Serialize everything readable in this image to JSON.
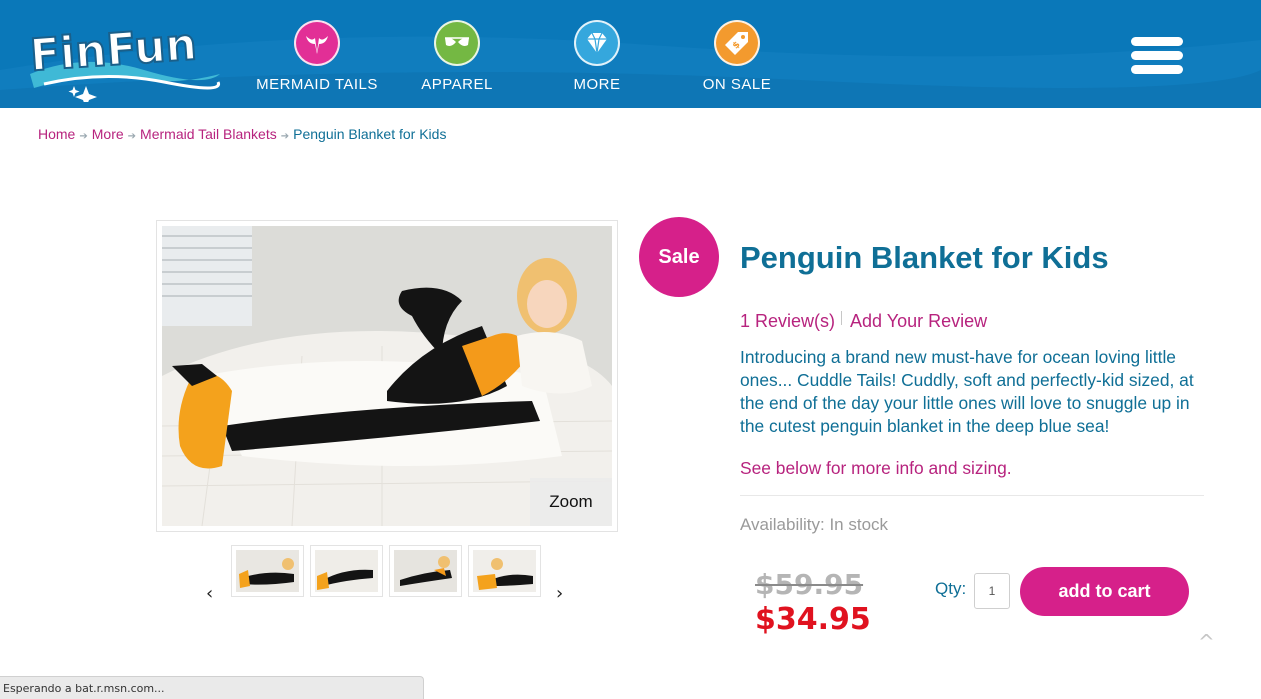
{
  "header": {
    "logo_text": "FinFun",
    "nav": [
      {
        "label": "MERMAID TAILS",
        "icon": "mermaid-tail-icon",
        "color": "#e22f96"
      },
      {
        "label": "APPAREL",
        "icon": "bikini-icon",
        "color": "#74b843"
      },
      {
        "label": "MORE",
        "icon": "diamond-icon",
        "color": "#35a7dd"
      },
      {
        "label": "ON SALE",
        "icon": "price-tag-icon",
        "color": "#f39a2e"
      }
    ],
    "menu_icon": "hamburger-menu-icon",
    "background": "#0a78b9"
  },
  "breadcrumb": {
    "items": [
      "Home",
      "More",
      "Mermaid Tail Blankets"
    ],
    "current": "Penguin Blanket for Kids"
  },
  "gallery": {
    "zoom_label": "Zoom",
    "prev_icon": "chevron-left-icon",
    "next_icon": "chevron-right-icon",
    "thumbnail_count": 4
  },
  "product": {
    "sale_badge": "Sale",
    "title": "Penguin Blanket for Kids",
    "reviews_link": "1 Review(s)",
    "add_review_link": "Add Your Review",
    "description": "Introducing a brand new must-have for ocean loving little ones... Cuddle Tails! Cuddly, soft and perfectly-kid sized, at the end of the day your little ones will love to snuggle up in the cutest penguin blanket in the deep blue sea!",
    "see_below": "See below for more info and sizing.",
    "availability": "Availability: In stock",
    "old_price": "$59.95",
    "new_price": "$34.95",
    "qty_label": "Qty:",
    "qty_value": "1",
    "add_to_cart": "add to cart"
  },
  "colors": {
    "accent_pink": "#d6208a",
    "link_magenta": "#b7237e",
    "text_teal": "#0f6f96",
    "price_red": "#e0121f"
  },
  "status_bar": "Esperando a bat.r.msn.com..."
}
